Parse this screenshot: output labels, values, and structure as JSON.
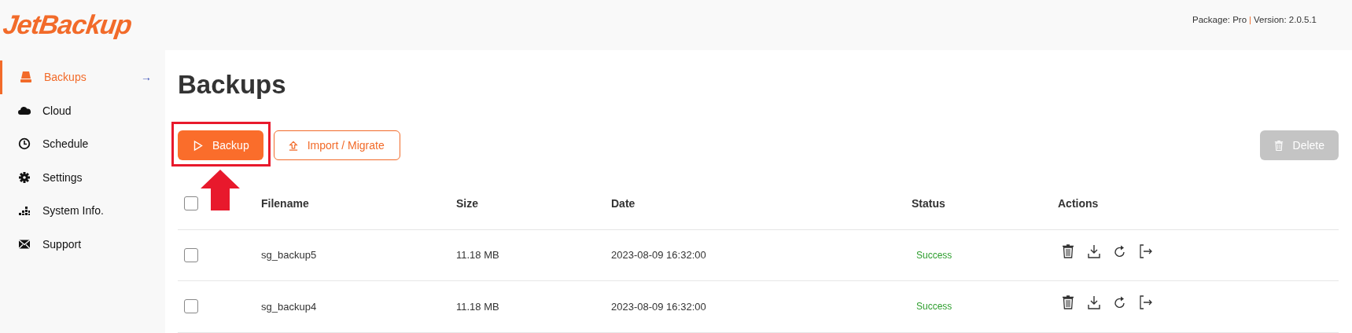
{
  "header": {
    "logo": "JetBackup",
    "package": "Package: Pro",
    "separator": "|",
    "version": "Version: 2.0.5.1"
  },
  "sidebar": {
    "items": [
      {
        "label": "Backups",
        "kind": "drive",
        "selected": true,
        "arrow": "→"
      },
      {
        "label": "Cloud",
        "kind": "cloud",
        "selected": false
      },
      {
        "label": "Schedule",
        "kind": "clock",
        "selected": false
      },
      {
        "label": "Settings",
        "kind": "gear",
        "selected": false
      },
      {
        "label": "System Info.",
        "kind": "bars",
        "selected": false
      },
      {
        "label": "Support",
        "kind": "envelope",
        "selected": false
      }
    ]
  },
  "page": {
    "title": "Backups"
  },
  "toolbar": {
    "backup_button": {
      "label": "Backup",
      "highlighted": true
    },
    "import_button": {
      "label": "Import / Migrate"
    },
    "delete_button": {
      "label": "Delete",
      "disabled": true
    }
  },
  "table": {
    "select_all": {
      "checked": false
    },
    "columns": [
      "Filename",
      "Size",
      "Date",
      "Status",
      "Actions"
    ],
    "rows": [
      {
        "checked": false,
        "filename": "sg_backup5",
        "size": "11.18 MB",
        "date": "2023-08-09 16:32:00",
        "status": "Success",
        "color": "#2e9e2e"
      },
      {
        "checked": false,
        "filename": "sg_backup4",
        "size": "11.18 MB",
        "date": "2023-08-09 16:32:00",
        "status": "Success",
        "color": "#2e9e2e"
      }
    ]
  }
}
